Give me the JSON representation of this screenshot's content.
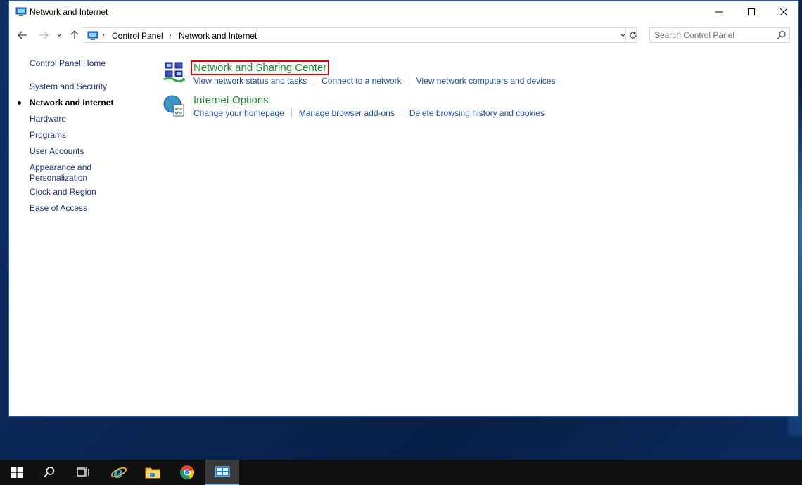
{
  "window": {
    "title": "Network and Internet"
  },
  "navigation": {
    "breadcrumbs": [
      "Control Panel",
      "Network and Internet"
    ],
    "search_placeholder": "Search Control Panel"
  },
  "sidebar": {
    "items": [
      {
        "label": "Control Panel Home",
        "active": false
      },
      {
        "label": "System and Security",
        "active": false
      },
      {
        "label": "Network and Internet",
        "active": true
      },
      {
        "label": "Hardware",
        "active": false
      },
      {
        "label": "Programs",
        "active": false
      },
      {
        "label": "User Accounts",
        "active": false
      },
      {
        "label": "Appearance and Personalization",
        "active": false
      },
      {
        "label": "Clock and Region",
        "active": false
      },
      {
        "label": "Ease of Access",
        "active": false
      }
    ]
  },
  "categories": [
    {
      "title": "Network and Sharing Center",
      "icon": "network-sharing-icon",
      "links": [
        "View network status and tasks",
        "Connect to a network",
        "View network computers and devices"
      ]
    },
    {
      "title": "Internet Options",
      "icon": "internet-options-icon",
      "links": [
        "Change your homepage",
        "Manage browser add-ons",
        "Delete browsing history and cookies"
      ]
    }
  ],
  "taskbar": {
    "items": [
      "start-icon",
      "search-icon",
      "task-view-icon",
      "internet-explorer-icon",
      "file-explorer-icon",
      "chrome-icon",
      "control-panel-icon"
    ]
  },
  "colors": {
    "link": "#1e4fa8",
    "category_title": "#1a8a2e",
    "highlight_border": "#e00000",
    "taskbar": "#101010"
  }
}
